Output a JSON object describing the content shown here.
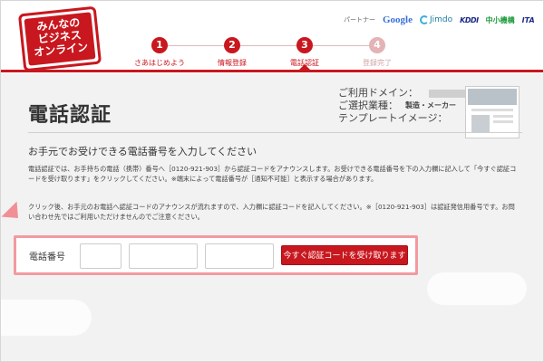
{
  "logo": {
    "text": "みんなの\nビジネス\nオンライン"
  },
  "partners": {
    "label": "パートナー",
    "items": [
      "Google",
      "Jimdo",
      "KDDI",
      "中小機構",
      "ITA"
    ]
  },
  "steps": [
    {
      "num": "1",
      "label": "さあはじめよう",
      "state": "done"
    },
    {
      "num": "2",
      "label": "情報登録",
      "state": "done"
    },
    {
      "num": "3",
      "label": "電話認証",
      "state": "current"
    },
    {
      "num": "4",
      "label": "登録完了",
      "state": "disabled"
    }
  ],
  "page": {
    "title": "電話認証",
    "meta": {
      "domain_label": "ご利用ドメイン：",
      "industry_label": "ご選択業種：",
      "industry_value": "製造・メーカー",
      "template_label": "テンプレートイメージ："
    },
    "subheading": "お手元でお受けできる電話番号を入力してください",
    "paragraph1": "電話認証では、お手持ちの電話（携帯）番号へ［0120-921-903］から認証コードをアナウンスします。お受けできる電話番号を下の入力欄に記入して「今すぐ認証コードを受け取ります」をクリックしてください。※端末によって電話番号が［通知不可能］と表示する場合があります。",
    "paragraph2": "クリック後、お手元のお電話へ認証コードのアナウンスが流れますので、入力欄に認証コードを記入してください。※［0120-921-903］は認証発信用番号です。お問い合わせ先ではご利用いただけませんのでご注意ください。"
  },
  "form": {
    "phone_label": "電話番号",
    "field1_value": "",
    "field2_value": "",
    "field3_value": "",
    "submit_label": "今すぐ認証コードを受け取ります"
  },
  "colors": {
    "accent": "#c8171e",
    "highlight": "#f29aa1"
  }
}
